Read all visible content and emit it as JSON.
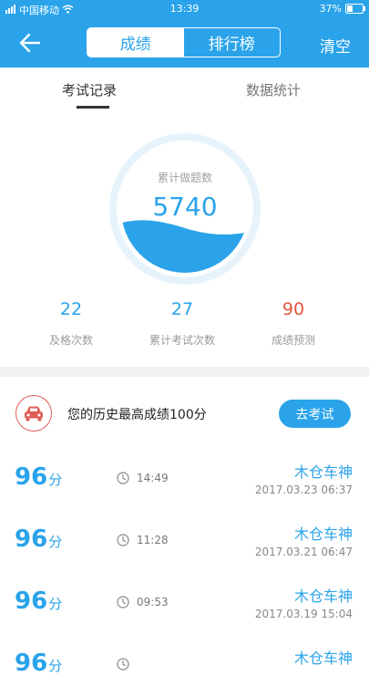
{
  "status_bar": {
    "carrier": "中国移动",
    "time": "13:39",
    "battery_percent": "37%",
    "battery_level": 0.37
  },
  "nav": {
    "back_icon": "back-arrow-icon",
    "segments": [
      "成绩",
      "排行榜"
    ],
    "active_segment": 0,
    "right_action": "清空"
  },
  "tabs": {
    "items": [
      "考试记录",
      "数据统计"
    ],
    "active": 0
  },
  "gauge": {
    "title": "累计做题数",
    "value": "5740"
  },
  "stats": [
    {
      "value": "22",
      "label": "及格次数"
    },
    {
      "value": "27",
      "label": "累计考试次数"
    },
    {
      "value": "90",
      "label": "成绩预测"
    }
  ],
  "best": {
    "icon": "car-icon",
    "text": "您的历史最高成绩100分",
    "button": "去考试"
  },
  "records": [
    {
      "score": "96",
      "unit": "分",
      "duration": "14:49",
      "name": "木仓车神",
      "date": "2017.03.23   06:37"
    },
    {
      "score": "96",
      "unit": "分",
      "duration": "11:28",
      "name": "木仓车神",
      "date": "2017.03.21   06:47"
    },
    {
      "score": "96",
      "unit": "分",
      "duration": "09:53",
      "name": "木仓车神",
      "date": "2017.03.19   15:04"
    },
    {
      "score": "96",
      "unit": "分",
      "duration": "",
      "name": "木仓车神",
      "date": ""
    }
  ],
  "colors": {
    "primary": "#2aa3ea",
    "prediction": "#e2543f",
    "badge": "#e05d58"
  }
}
